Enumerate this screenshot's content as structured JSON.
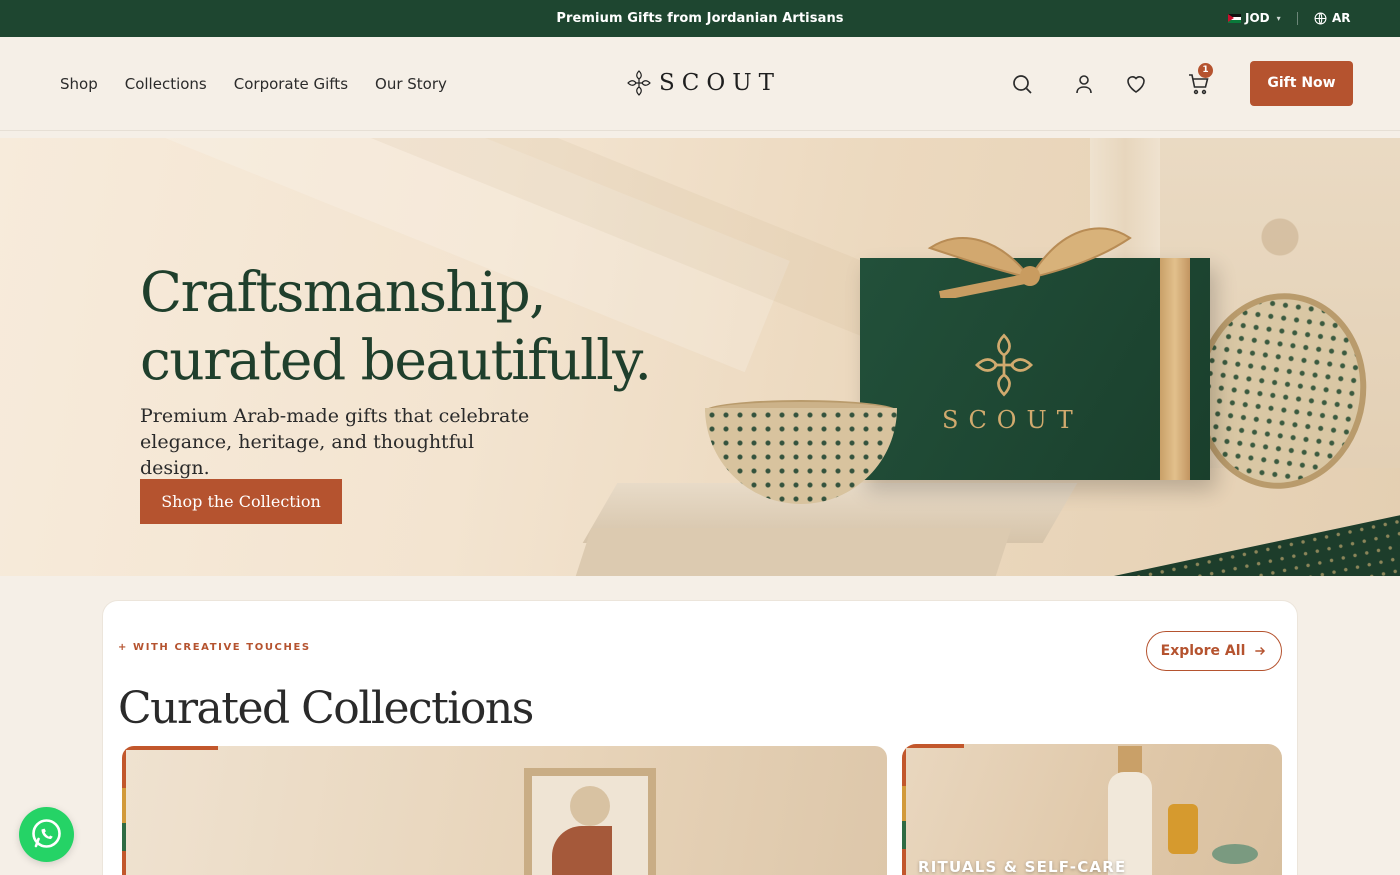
{
  "announcement": {
    "message": "Premium Gifts from Jordanian Artisans",
    "currency": "JOD",
    "language": "AR"
  },
  "header": {
    "nav": [
      "Shop",
      "Collections",
      "Corporate Gifts",
      "Our Story"
    ],
    "brand": "SCOUT",
    "cart_count": "1",
    "cta_label": "Gift Now",
    "icons": [
      "search-icon",
      "account-icon",
      "wishlist-heart-icon",
      "cart-icon"
    ]
  },
  "hero": {
    "title_line1": "Craftsmanship,",
    "title_line2": "curated beautifully.",
    "subtitle": "Premium Arab-made gifts that celebrate elegance, heritage, and thoughtful design.",
    "cta_label": "Shop the Collection",
    "box_brand": "SCOUT"
  },
  "collections": {
    "eyebrow": "+ WITH CREATIVE TOUCHES",
    "title": "Curated Collections",
    "explore_label": "Explore All",
    "cards": [
      {
        "label": ""
      },
      {
        "label": "RITUALS & SELF-CARE"
      }
    ]
  },
  "colors": {
    "brand_green": "#1e4630",
    "accent_terracotta": "#b5532f",
    "background": "#f5efe7"
  }
}
